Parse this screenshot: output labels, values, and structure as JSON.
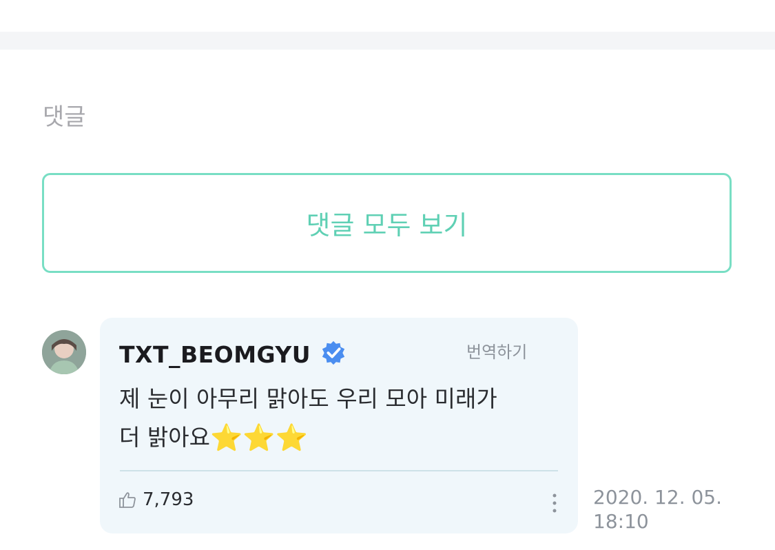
{
  "section": {
    "title": "댓글"
  },
  "view_all": {
    "label": "댓글 모두 보기"
  },
  "comment": {
    "username": "TXT_BEOMGYU",
    "verified": true,
    "translate_label": "번역하기",
    "text_line1": "제 눈이 아무리 맑아도 우리 모아 미래가",
    "text_line2": "더 밝아요",
    "emoji": "⭐⭐⭐",
    "likes": "7,793",
    "date": "2020. 12. 05.",
    "time": "18:10"
  },
  "colors": {
    "accent": "#5fd0b4",
    "border": "#78dec4",
    "bubble_bg": "#f0f7fb",
    "verified_badge": "#4b8ef0",
    "muted": "#8d939b"
  },
  "icons": [
    "avatar",
    "verified-badge-icon",
    "thumbs-up-icon",
    "more-vertical-icon"
  ]
}
